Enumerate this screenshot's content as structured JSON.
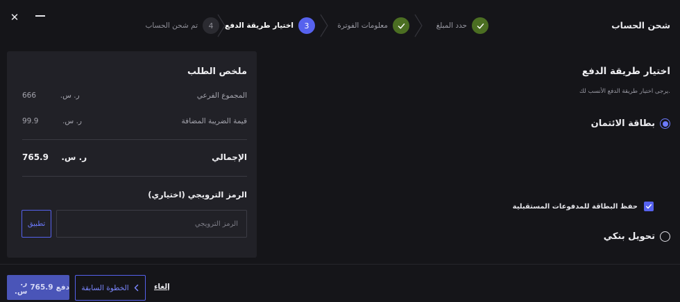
{
  "header": {
    "title": "شحن الحساب"
  },
  "stepper": {
    "steps": [
      {
        "number": "1",
        "label": "حدد المبلغ",
        "state": "done"
      },
      {
        "number": "2",
        "label": "معلومات الفوترة",
        "state": "done"
      },
      {
        "number": "3",
        "label": "اختيار طريقة الدفع",
        "state": "active"
      },
      {
        "number": "4",
        "label": "تم شحن الحساب",
        "state": "pending"
      }
    ]
  },
  "payment": {
    "title": "اختيار طريقة الدفع",
    "subtitle": "يرجى اختيار طريقة الدفع الأنسب لك.",
    "options": [
      {
        "label": "بطاقة الائتمان",
        "selected": true
      },
      {
        "label": "تحويل بنكي",
        "selected": false
      }
    ],
    "save_card_label": "حفظ البطاقة للمدفوعات المستقبلية",
    "save_card_checked": true
  },
  "summary": {
    "title": "ملخص الطلب",
    "rows": [
      {
        "label": "المجموع الفرعي",
        "value": "666",
        "currency": "ر. س."
      },
      {
        "label": "قيمة الضريبة المضافة",
        "value": "99.9",
        "currency": "ر. س."
      }
    ],
    "total": {
      "label": "الإجمالي",
      "value": "765.9",
      "currency": "ر. س."
    },
    "promo": {
      "title": "الرمز الترويجي (اختياري)",
      "placeholder": "الرمز الترويجي",
      "apply_label": "تطبيق"
    }
  },
  "footer": {
    "pay_label": "دفع",
    "pay_amount": "765.9",
    "pay_currency": "ر. س.",
    "prev_label": "الخطوة السابقة",
    "cancel_label": "إلغاء"
  },
  "colors": {
    "accent": "#5662ee",
    "done": "#4b6e22",
    "background": "#151519",
    "panel": "#212127"
  }
}
